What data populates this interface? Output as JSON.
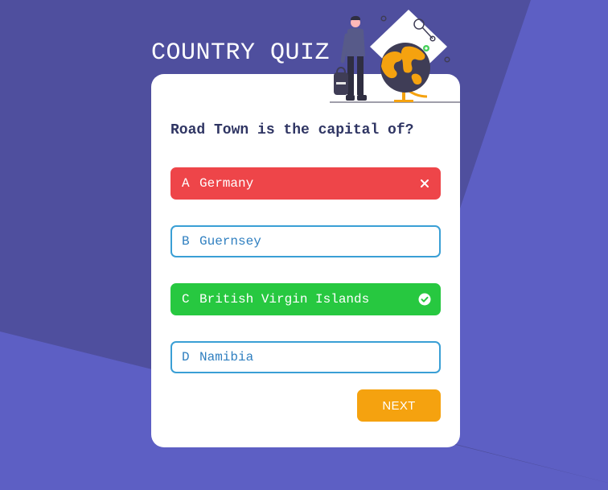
{
  "header": {
    "title": "COUNTRY QUIZ"
  },
  "quiz": {
    "question": "Road Town is the capital of?",
    "options": [
      {
        "letter": "A",
        "text": "Germany",
        "state": "wrong"
      },
      {
        "letter": "B",
        "text": "Guernsey",
        "state": "neutral"
      },
      {
        "letter": "C",
        "text": "British Virgin Islands",
        "state": "correct"
      },
      {
        "letter": "D",
        "text": "Namibia",
        "state": "neutral"
      }
    ],
    "next_label": "NEXT"
  },
  "colors": {
    "background_dark": "#4f4f9e",
    "background_light": "#5d5fc4",
    "card": "#ffffff",
    "wrong": "#ee4549",
    "correct": "#27c840",
    "option_border": "#3a9fd5",
    "button": "#f5a20f",
    "question_text": "#2f3563"
  },
  "icons": {
    "wrong_marker": "close-icon",
    "correct_marker": "check-circle-icon",
    "hero": "traveler-with-globe-illustration"
  }
}
